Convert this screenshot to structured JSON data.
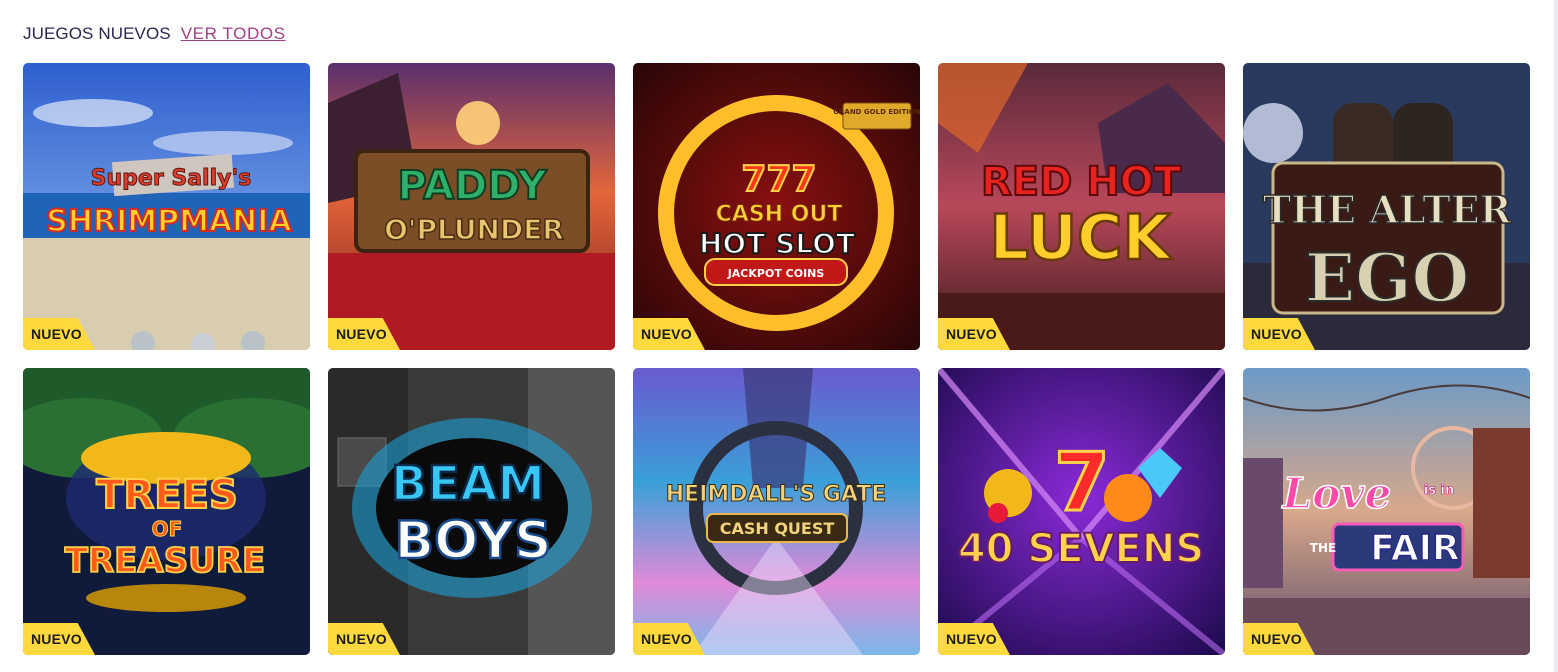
{
  "section": {
    "title": "JUEGOS NUEVOS",
    "view_all_label": "VER TODOS"
  },
  "badge_label": "NUEVO",
  "games": [
    {
      "logo_lines": [
        "Super Sally's",
        "SHRIMPMANIA"
      ]
    },
    {
      "logo_lines": [
        "PADDY",
        "O'PLUNDER"
      ]
    },
    {
      "logo_lines": [
        "GRAND GOLD EDITION",
        "777",
        "CASH OUT",
        "HOT SLOT",
        "JACKPOT COINS"
      ]
    },
    {
      "logo_lines": [
        "RED HOT",
        "LUCK"
      ]
    },
    {
      "logo_lines": [
        "THE ALTER",
        "EGO"
      ]
    },
    {
      "logo_lines": [
        "TREES",
        "OF",
        "TREASURE"
      ]
    },
    {
      "logo_lines": [
        "BEAM",
        "BOYS"
      ]
    },
    {
      "logo_lines": [
        "HEIMDALL'S GATE",
        "CASH QUEST"
      ]
    },
    {
      "logo_lines": [
        "40 SEVENS"
      ]
    },
    {
      "logo_lines": [
        "Love",
        "is in",
        "THE",
        "FAIR"
      ]
    }
  ]
}
